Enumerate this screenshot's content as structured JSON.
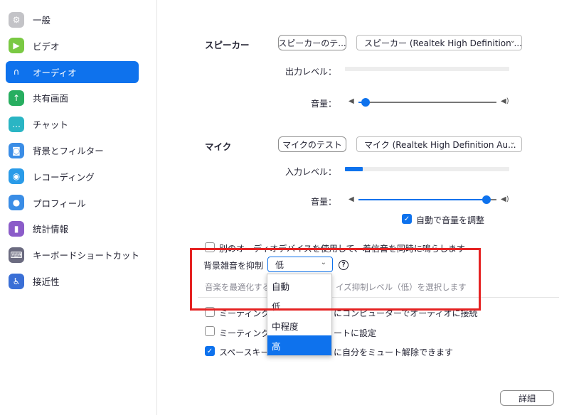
{
  "sidebar": {
    "items": [
      {
        "label": "一般",
        "icon": "gear-icon",
        "color": "#c3c3c7",
        "glyph": "⚙"
      },
      {
        "label": "ビデオ",
        "icon": "video-camera-icon",
        "color": "#7ac943",
        "glyph": "▶"
      },
      {
        "label": "オーディオ",
        "icon": "headphones-icon",
        "color": "#0e72ed",
        "glyph": "∩"
      },
      {
        "label": "共有画面",
        "icon": "share-screen-icon",
        "color": "#27ae60",
        "glyph": "↑"
      },
      {
        "label": "チャット",
        "icon": "chat-bubble-icon",
        "color": "#2ab5c4",
        "glyph": "…"
      },
      {
        "label": "背景とフィルター",
        "icon": "background-icon",
        "color": "#3a8de6",
        "glyph": "◙"
      },
      {
        "label": "レコーディング",
        "icon": "record-icon",
        "color": "#2a9be8",
        "glyph": "◉"
      },
      {
        "label": "プロフィール",
        "icon": "profile-icon",
        "color": "#3a8de6",
        "glyph": "●"
      },
      {
        "label": "統計情報",
        "icon": "statistics-icon",
        "color": "#8b5cc9",
        "glyph": "▮"
      },
      {
        "label": "キーボードショートカット",
        "icon": "keyboard-icon",
        "color": "#6b6b80",
        "glyph": "⌨"
      },
      {
        "label": "接近性",
        "icon": "accessibility-icon",
        "color": "#3a6fd6",
        "glyph": "♿"
      }
    ]
  },
  "speaker": {
    "label": "スピーカー",
    "test_button": "スピーカーのテ...",
    "device": "スピーカー (Realtek High Definition ...",
    "output_level_label": "出力レベル：",
    "output_level": 0,
    "volume_label": "音量：",
    "volume": 0.05
  },
  "mic": {
    "label": "マイク",
    "test_button": "マイクのテスト",
    "device": "マイク (Realtek High Definition Au...",
    "input_level_label": "入力レベル：",
    "input_level": 0.11,
    "volume_label": "音量：",
    "volume": 0.93,
    "auto_adjust_label": "自動で音量を調整",
    "auto_adjust": true
  },
  "options": {
    "separate_ringtone": "別のオーディオデバイスを使用して、着信音を同時に鳴らします",
    "noise_label": "背景雑音を抑制",
    "noise_value": "低",
    "noise_desc_left": "音楽を最適化する",
    "noise_desc_right": "イズ抑制レベル（低）を選択します",
    "join_audio_left": "ミーティングへ",
    "join_audio_right": "にコンピューターでオーディオに接続",
    "mute_left": "ミーティングの参",
    "mute_right": "ートに設定",
    "space_left": "スペースキーを",
    "space_right": "に自分をミュート解除できます"
  },
  "dropdown": {
    "options": [
      "自動",
      "低",
      "中程度",
      "高"
    ],
    "highlighted": "高"
  },
  "footer": {
    "advanced_button": "詳細"
  },
  "colors": {
    "accent": "#0e72ed",
    "highlight_box": "#e52222"
  }
}
